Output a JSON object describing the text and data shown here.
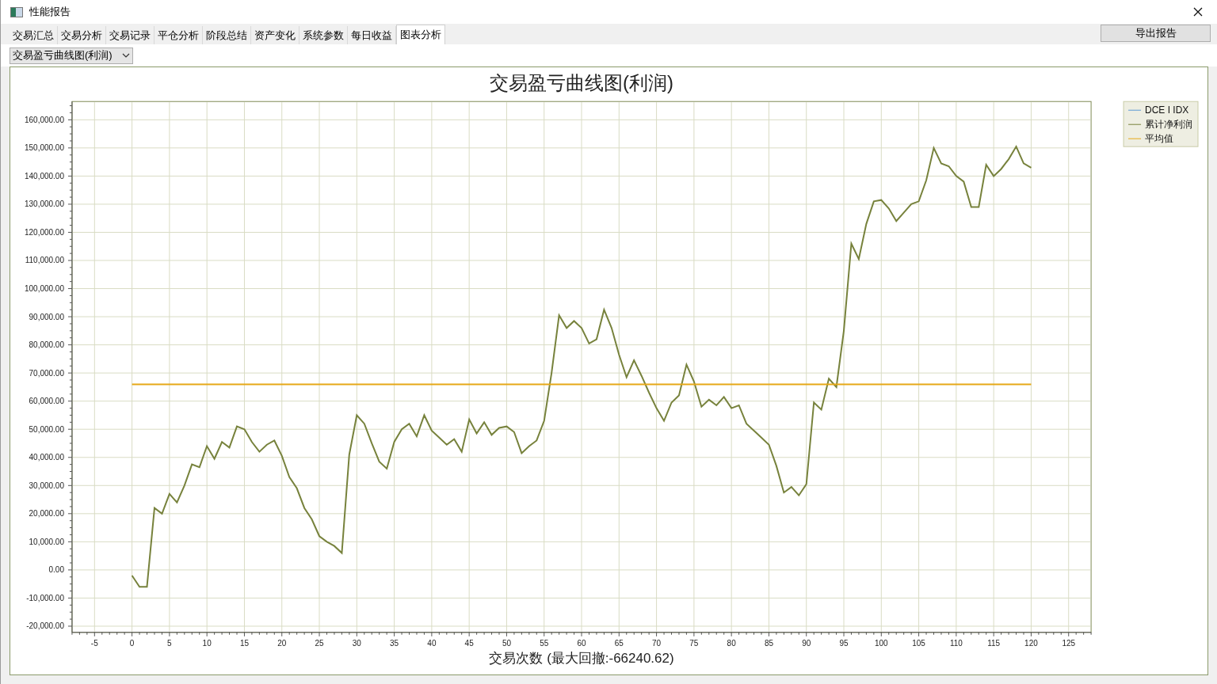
{
  "window": {
    "title": "性能报告"
  },
  "tabs": [
    {
      "label": "交易汇总",
      "selected": false
    },
    {
      "label": "交易分析",
      "selected": false
    },
    {
      "label": "交易记录",
      "selected": false
    },
    {
      "label": "平仓分析",
      "selected": false
    },
    {
      "label": "阶段总结",
      "selected": false
    },
    {
      "label": "资产变化",
      "selected": false
    },
    {
      "label": "系统参数",
      "selected": false
    },
    {
      "label": "每日收益",
      "selected": false
    },
    {
      "label": "图表分析",
      "selected": true
    }
  ],
  "export_button": "导出报告",
  "chart_select": {
    "value": "交易盈亏曲线图(利润)"
  },
  "chart": {
    "chart_data": {
      "type": "line",
      "title": "交易盈亏曲线图(利润)",
      "xlabel": "交易次数 (最大回撤:-66240.62)",
      "x": [
        0,
        1,
        2,
        3,
        4,
        5,
        6,
        7,
        8,
        9,
        10,
        11,
        12,
        13,
        14,
        15,
        16,
        17,
        18,
        19,
        20,
        21,
        22,
        23,
        24,
        25,
        26,
        27,
        28,
        29,
        30,
        31,
        32,
        33,
        34,
        35,
        36,
        37,
        38,
        39,
        40,
        41,
        42,
        43,
        44,
        45,
        46,
        47,
        48,
        49,
        50,
        51,
        52,
        53,
        54,
        55,
        56,
        57,
        58,
        59,
        60,
        61,
        62,
        63,
        64,
        65,
        66,
        67,
        68,
        69,
        70,
        71,
        72,
        73,
        74,
        75,
        76,
        77,
        78,
        79,
        80,
        81,
        82,
        83,
        84,
        85,
        86,
        87,
        88,
        89,
        90,
        91,
        92,
        93,
        94,
        95,
        96,
        97,
        98,
        99,
        100,
        101,
        102,
        103,
        104,
        105,
        106,
        107,
        108,
        109,
        110,
        111,
        112,
        113,
        114,
        115,
        116,
        117,
        118,
        119,
        120
      ],
      "series": [
        {
          "name": "DCE I IDX",
          "color": "#5b9bd5",
          "values": [
            null,
            null,
            null,
            null,
            null,
            null,
            null,
            null,
            null,
            null,
            null,
            null,
            null,
            null,
            null,
            null,
            null,
            null,
            null,
            null,
            null,
            null,
            null,
            null,
            null,
            null,
            null,
            null,
            null,
            null,
            null,
            null,
            null,
            null,
            null,
            null,
            null,
            null,
            null,
            null,
            null,
            null,
            null,
            null,
            null,
            null,
            null,
            null,
            null,
            null,
            null,
            null,
            null,
            null,
            null,
            null,
            null,
            null,
            null,
            null,
            null,
            null,
            null,
            null,
            null,
            null,
            null,
            null,
            null,
            null,
            null,
            null,
            null,
            null,
            null,
            null,
            null,
            null,
            null,
            null,
            null,
            null,
            null,
            null,
            null,
            null,
            null,
            null,
            null,
            null,
            null,
            null,
            null,
            null,
            null,
            null,
            null,
            null,
            null,
            null,
            null,
            null,
            null,
            null,
            null,
            null,
            null,
            null,
            null,
            null,
            null,
            null,
            null,
            null,
            null,
            null,
            null,
            null,
            null,
            null,
            null
          ]
        },
        {
          "name": "累计净利润",
          "color": "#77823c",
          "values": [
            -2000,
            -6000,
            -6000,
            22000,
            20000,
            27000,
            24000,
            30000,
            37500,
            36500,
            44000,
            39500,
            45500,
            43500,
            51000,
            50000,
            45500,
            42000,
            44500,
            46000,
            40500,
            33000,
            29000,
            22000,
            18000,
            12000,
            10000,
            8500,
            6000,
            41000,
            55000,
            52000,
            45000,
            38500,
            36000,
            45500,
            50000,
            52000,
            47500,
            55000,
            49500,
            47000,
            44500,
            46500,
            42000,
            53500,
            48500,
            52500,
            48000,
            50500,
            51000,
            49000,
            41500,
            44000,
            46000,
            53000,
            70000,
            90500,
            86000,
            88500,
            86000,
            80500,
            82000,
            92500,
            86000,
            76500,
            68500,
            74500,
            69000,
            63000,
            57500,
            53000,
            59500,
            62000,
            73000,
            67000,
            58000,
            60500,
            58500,
            61500,
            57500,
            58500,
            52000,
            49500,
            47000,
            44500,
            37000,
            27500,
            29500,
            26500,
            30500,
            59500,
            57000,
            68000,
            65000,
            85000,
            116000,
            110500,
            123000,
            131000,
            131500,
            128500,
            124000,
            127000,
            130000,
            131000,
            138500,
            150000,
            144500,
            143500,
            140000,
            138000,
            129000,
            129000,
            144000,
            140000,
            142500,
            146000,
            150500,
            144500,
            143000
          ]
        },
        {
          "name": "平均值",
          "color": "#e6a817",
          "values": [
            66000,
            66000,
            66000,
            66000,
            66000,
            66000,
            66000,
            66000,
            66000,
            66000,
            66000,
            66000,
            66000,
            66000,
            66000,
            66000,
            66000,
            66000,
            66000,
            66000,
            66000,
            66000,
            66000,
            66000,
            66000,
            66000,
            66000,
            66000,
            66000,
            66000,
            66000,
            66000,
            66000,
            66000,
            66000,
            66000,
            66000,
            66000,
            66000,
            66000,
            66000,
            66000,
            66000,
            66000,
            66000,
            66000,
            66000,
            66000,
            66000,
            66000,
            66000,
            66000,
            66000,
            66000,
            66000,
            66000,
            66000,
            66000,
            66000,
            66000,
            66000,
            66000,
            66000,
            66000,
            66000,
            66000,
            66000,
            66000,
            66000,
            66000,
            66000,
            66000,
            66000,
            66000,
            66000,
            66000,
            66000,
            66000,
            66000,
            66000,
            66000,
            66000,
            66000,
            66000,
            66000,
            66000,
            66000,
            66000,
            66000,
            66000,
            66000,
            66000,
            66000,
            66000,
            66000,
            66000,
            66000,
            66000,
            66000,
            66000,
            66000,
            66000,
            66000,
            66000,
            66000,
            66000,
            66000,
            66000,
            66000,
            66000,
            66000,
            66000,
            66000,
            66000,
            66000,
            66000,
            66000,
            66000,
            66000,
            66000,
            66000
          ]
        }
      ],
      "grid": true,
      "legend": true,
      "xlim": [
        -8,
        128
      ],
      "ylim": [
        -22200,
        166500
      ],
      "xticks": [
        -5,
        0,
        5,
        10,
        15,
        20,
        25,
        30,
        35,
        40,
        45,
        50,
        55,
        60,
        65,
        70,
        75,
        80,
        85,
        90,
        95,
        100,
        105,
        110,
        115,
        120,
        125
      ],
      "yticks": [
        {
          "value": -20000,
          "label": "-20,000.00"
        },
        {
          "value": -10000,
          "label": "-10,000.00"
        },
        {
          "value": 0,
          "label": "0.00"
        },
        {
          "value": 10000,
          "label": "10,000.00"
        },
        {
          "value": 20000,
          "label": "20,000.00"
        },
        {
          "value": 30000,
          "label": "30,000.00"
        },
        {
          "value": 40000,
          "label": "40,000.00"
        },
        {
          "value": 50000,
          "label": "50,000.00"
        },
        {
          "value": 60000,
          "label": "60,000.00"
        },
        {
          "value": 70000,
          "label": "70,000.00"
        },
        {
          "value": 80000,
          "label": "80,000.00"
        },
        {
          "value": 90000,
          "label": "90,000.00"
        },
        {
          "value": 100000,
          "label": "100,000.00"
        },
        {
          "value": 110000,
          "label": "110,000.00"
        },
        {
          "value": 120000,
          "label": "120,000.00"
        },
        {
          "value": 130000,
          "label": "130,000.00"
        },
        {
          "value": 140000,
          "label": "140,000.00"
        },
        {
          "value": 150000,
          "label": "150,000.00"
        },
        {
          "value": 160000,
          "label": "160,000.00"
        }
      ]
    }
  }
}
